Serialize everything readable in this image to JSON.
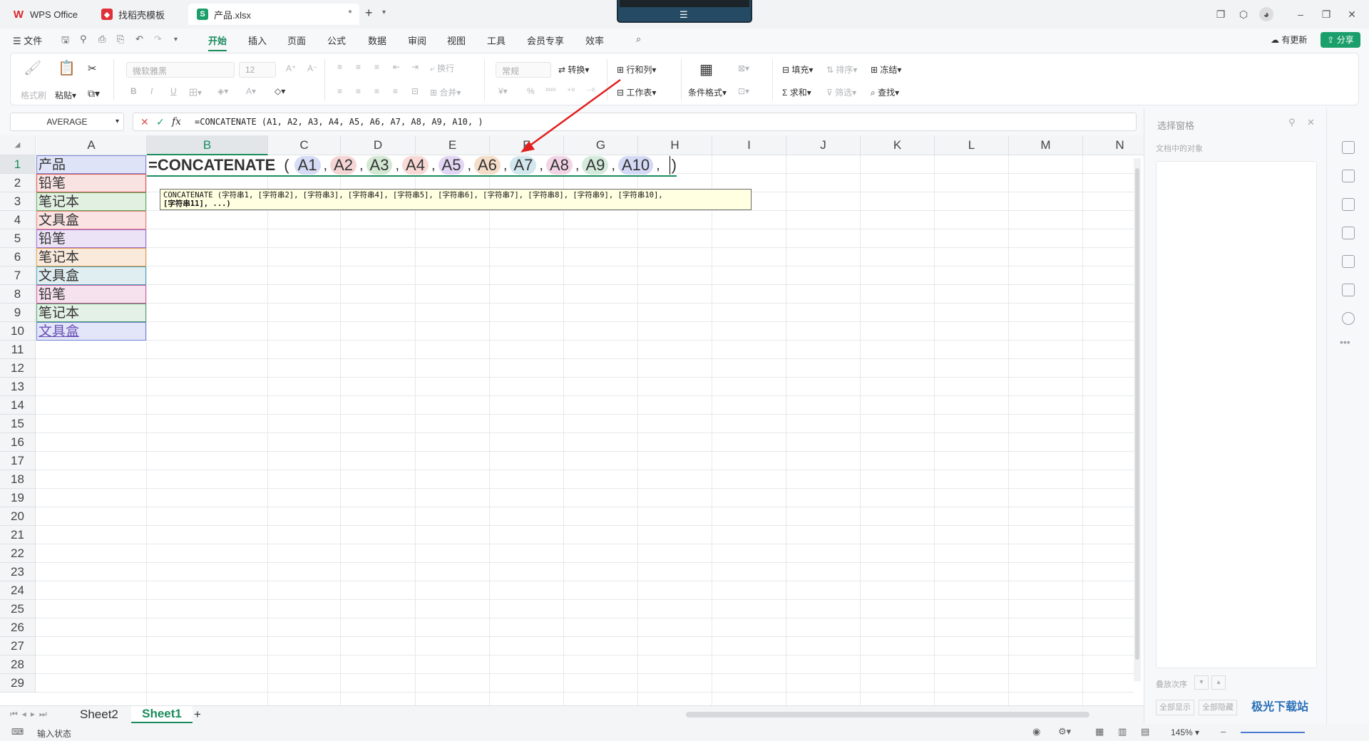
{
  "tabs": [
    {
      "label": "WPS Office",
      "icon": "wps-logo-icon"
    },
    {
      "label": "找稻壳模板",
      "icon": "docer-icon"
    },
    {
      "label": "产品.xlsx",
      "icon": "spreadsheet-icon",
      "badge": "S"
    }
  ],
  "menu": {
    "file": "文件",
    "items": [
      "开始",
      "插入",
      "页面",
      "公式",
      "数据",
      "审阅",
      "视图",
      "工具",
      "会员专享",
      "效率"
    ],
    "active": "开始",
    "update": "有更新",
    "share": "分享"
  },
  "ribbon": {
    "format_painter": "格式刷",
    "paste": "粘贴",
    "font_name": "微软雅黑",
    "font_size": "12",
    "wrap": "换行",
    "merge": "合并",
    "number_format": "常规",
    "convert": "转换",
    "rows_cols": "行和列",
    "worksheet": "工作表",
    "cond_format": "条件格式",
    "fill": "填充",
    "sort": "排序",
    "freeze": "冻结",
    "sum": "求和",
    "filter": "筛选",
    "find": "查找"
  },
  "formula_bar": {
    "name_box": "AVERAGE",
    "fx": "fx",
    "content": "=CONCATENATE (A1, A2, A3, A4, A5, A6, A7, A8, A9, A10, )"
  },
  "columns": [
    "A",
    "B",
    "C",
    "D",
    "E",
    "F",
    "G",
    "H",
    "I",
    "J",
    "K",
    "L",
    "M",
    "N"
  ],
  "rows": [
    "1",
    "2",
    "3",
    "4",
    "5",
    "6",
    "7",
    "8",
    "9",
    "10",
    "11",
    "12",
    "13",
    "14",
    "15",
    "16",
    "17",
    "18",
    "19",
    "20",
    "21",
    "22",
    "23",
    "24",
    "25",
    "26",
    "27",
    "28",
    "29"
  ],
  "column_a": [
    "产品",
    "铅笔",
    "笔记本",
    "文具盒",
    "铅笔",
    "笔记本",
    "文具盒",
    "铅笔",
    "笔记本",
    "文具盒"
  ],
  "cell_colors": [
    "#dfe3f7",
    "#f8e2e2",
    "#e2f0e2",
    "#fbe3e3",
    "#ece3f7",
    "#faeadc",
    "#e0eef2",
    "#f6e1ee",
    "#e3f1e6",
    "#e2e6f8"
  ],
  "cell_borders": [
    "#7b86d6",
    "#d9534f",
    "#5cae5c",
    "#e8807a",
    "#9a6cd6",
    "#e39a4a",
    "#4a9fb6",
    "#cc5c9e",
    "#4e9e6a",
    "#6f7fd6"
  ],
  "edit_formula": {
    "prefix": "=CONCATENATE",
    "open": "(",
    "refs": [
      "A1",
      "A2",
      "A3",
      "A4",
      "A5",
      "A6",
      "A7",
      "A8",
      "A9",
      "A10"
    ],
    "ref_colors": [
      "#d6dcf5",
      "#f5d4d4",
      "#d4e9d4",
      "#f8d9d6",
      "#e3d6f5",
      "#f5dec9",
      "#d2e7ee",
      "#f2d4e6",
      "#d4ebdc",
      "#d4daf5"
    ],
    "close": ")"
  },
  "tooltip": {
    "line1": "CONCATENATE (字符串1, [字符串2], [字符串3], [字符串4], [字符串5], [字符串6], [字符串7], [字符串8], [字符串9], [字符串10],",
    "line2": "[字符串11], ...)"
  },
  "sheets": [
    "Sheet2",
    "Sheet1"
  ],
  "active_sheet": "Sheet1",
  "status": {
    "mode": "输入状态",
    "zoom": "145%"
  },
  "right_panel": {
    "title": "选择窗格",
    "subtitle": "文档中的对象",
    "order_label": "叠放次序",
    "show_all": "全部显示",
    "hide_all": "全部隐藏"
  },
  "watermark": "极光下载站"
}
